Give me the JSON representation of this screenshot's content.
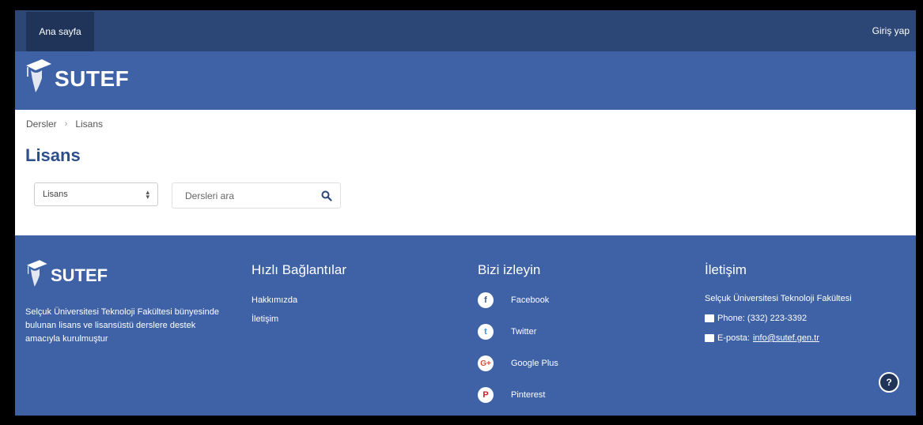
{
  "nav": {
    "home": "Ana sayfa",
    "login": "Giriş yap"
  },
  "brand": {
    "name": "SUTEF"
  },
  "breadcrumb": {
    "items": [
      "Dersler",
      "Lisans"
    ],
    "separator": "›"
  },
  "page": {
    "title": "Lisans"
  },
  "filter": {
    "selected": "Lisans"
  },
  "search": {
    "placeholder": "Dersleri ara"
  },
  "footer": {
    "about": "Selçuk Üniversitesi Teknoloji Fakültesi bünyesinde bulunan lisans ve lisansüstü derslere destek amacıyla kurulmuştur",
    "links_title": "Hızlı Bağlantılar",
    "links": [
      "Hakkımızda",
      "İletişim"
    ],
    "social_title": "Bizi izleyin",
    "social": [
      {
        "label": "Facebook",
        "glyph": "f",
        "color": "#3b5998"
      },
      {
        "label": "Twitter",
        "glyph": "t",
        "color": "#1da1f2"
      },
      {
        "label": "Google Plus",
        "glyph": "G+",
        "color": "#dd4b39"
      },
      {
        "label": "Pinterest",
        "glyph": "P",
        "color": "#cb2027"
      }
    ],
    "contact_title": "İletişim",
    "contact": {
      "org": "Selçuk Üniversitesi Teknoloji Fakültesi",
      "phone": "Phone: (332) 223-3392",
      "email_label": "E-posta:",
      "email": "info@sutef.gen.tr"
    }
  },
  "help": "?",
  "colors": {
    "nav": "#2c4775",
    "brand": "#3e62a5",
    "title": "#2c4f8c"
  }
}
